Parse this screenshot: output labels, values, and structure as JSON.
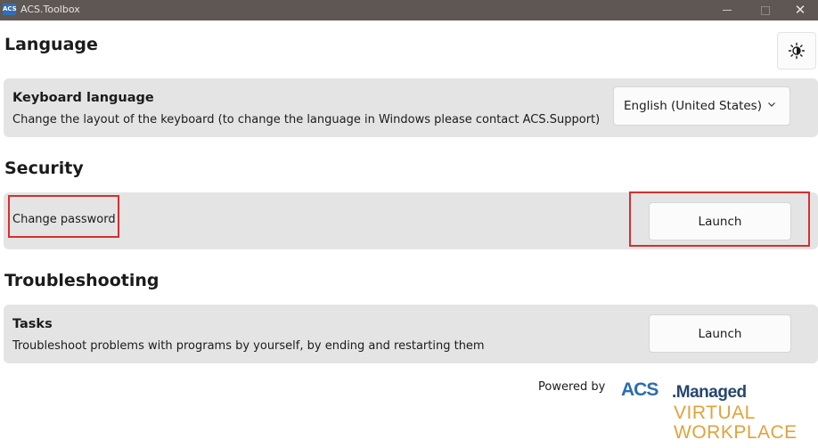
{
  "window": {
    "icon_text": "ACS",
    "title": "ACS.Toolbox"
  },
  "theme_toggle": {
    "icon": "sun-icon"
  },
  "language": {
    "heading": "Language",
    "keyboard": {
      "title": "Keyboard language",
      "description": "Change the layout of the keyboard (to change the language in Windows please contact ACS.Support)",
      "selected": "English (United States)"
    }
  },
  "security": {
    "heading": "Security",
    "change_password": {
      "label": "Change password",
      "button": "Launch"
    }
  },
  "troubleshooting": {
    "heading": "Troubleshooting",
    "tasks": {
      "title": "Tasks",
      "description": "Troubleshoot problems with programs by yourself, by ending and restarting them",
      "button": "Launch"
    }
  },
  "footer": {
    "powered_by": "Powered by",
    "logo": {
      "acs": "ACS",
      "managed": ".Managed",
      "line2": "VIRTUAL",
      "line3": "WORKPLACE"
    }
  },
  "colors": {
    "titlebar": "#5e5753",
    "card": "#e4e4e4",
    "highlight": "#d62f2f",
    "logo_blue": "#2a6db3",
    "logo_orange": "#e2a23a"
  }
}
